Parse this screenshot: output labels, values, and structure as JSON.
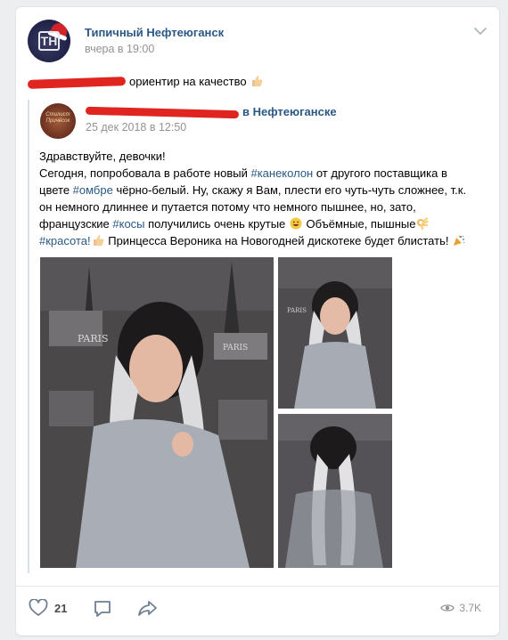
{
  "post": {
    "author": "Типичный Нефтеюганск",
    "date": "вчера в 19:00",
    "text": "ориентир на качество"
  },
  "repost": {
    "author_visible_suffix": "в Нефтеюганске",
    "date": "25 дек 2018 в 12:50",
    "avatar_text": "Стилист Причёсок",
    "body": {
      "line1": "Здравствуйте, девочки!",
      "line2_a": "Сегодня, попробовала в работе новый ",
      "tag_kanekalon": "#канеколон",
      "line2_b": " от другого поставщика в",
      "line3_a": "цвете ",
      "tag_ombre": "#омбре",
      "line3_b": " чёрно-белый. Ну, скажу я Вам, плести его чуть-чуть сложнее, т.к.",
      "line4": "он немного длиннее и путается потому что немного пышнее, но, зато,",
      "line5_a": "французские ",
      "tag_kosy": "#косы",
      "line5_b": " получились очень крутые ",
      "line5_c": " Объёмные, пышные",
      "tag_krasota": "#красота!",
      "line6_b": " Принцесса Вероника на Новогодней дискотеке будет блистать! "
    }
  },
  "actions": {
    "likes": "21",
    "views": "3.7K"
  },
  "icons": {
    "menu": "chevron-down-icon",
    "like": "heart-icon",
    "comment": "comment-icon",
    "share": "share-icon",
    "views": "eye-icon"
  },
  "colors": {
    "link": "#2a5885",
    "background": "#edeef0",
    "redacted_scribble": "#e0241f"
  }
}
